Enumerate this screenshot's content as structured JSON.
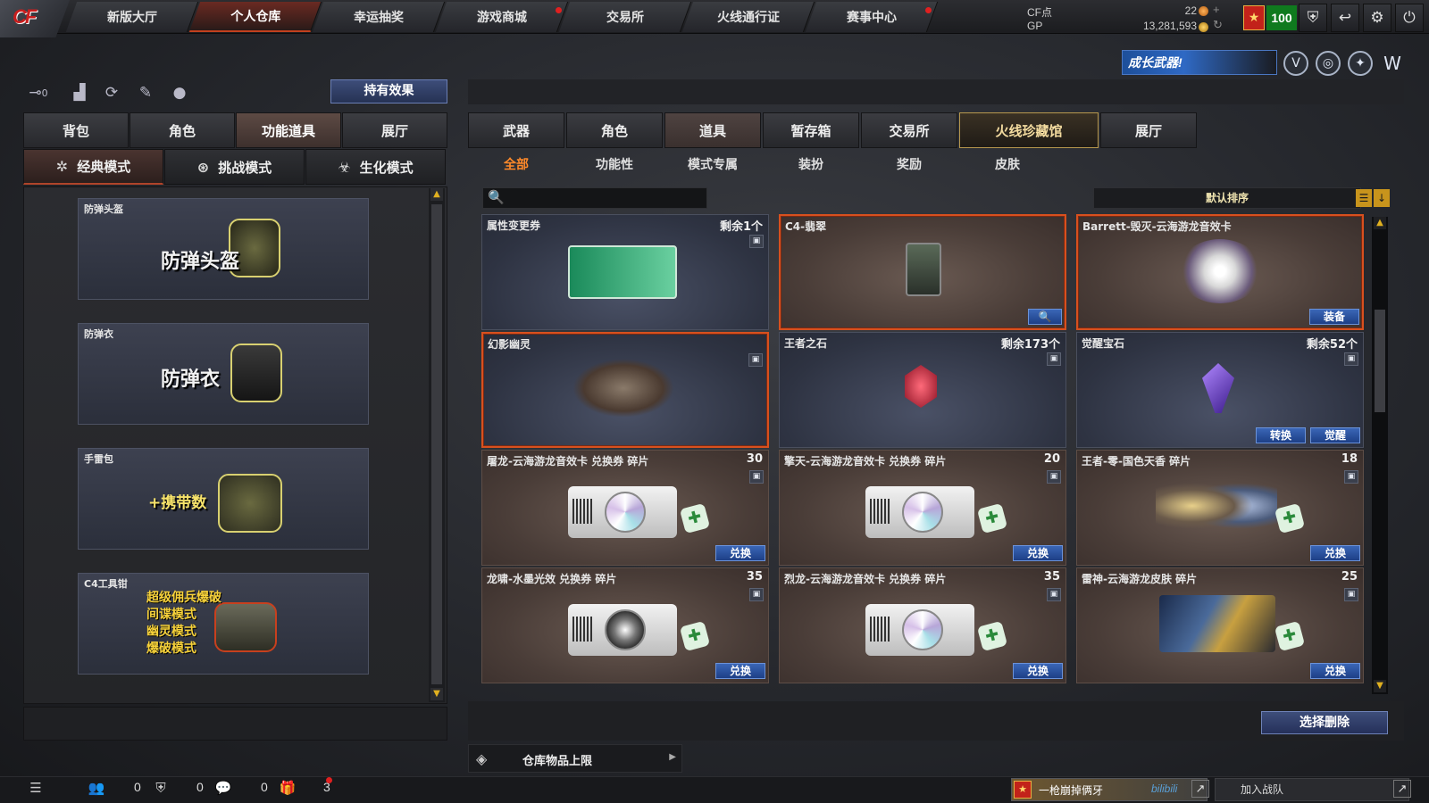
{
  "nav": {
    "logo": "CF",
    "tabs": [
      {
        "label": "新版大厅",
        "dot": false
      },
      {
        "label": "个人仓库",
        "dot": false
      },
      {
        "label": "幸运抽奖",
        "dot": false
      },
      {
        "label": "游戏商城",
        "dot": true
      },
      {
        "label": "交易所",
        "dot": false
      },
      {
        "label": "火线通行证",
        "dot": false
      },
      {
        "label": "赛事中心",
        "dot": true
      }
    ],
    "currency": {
      "cf_label": "CF点",
      "cf_value": "22",
      "gp_label": "GP",
      "gp_value": "13,281,593"
    },
    "level": "100"
  },
  "header_icons": {
    "growth_weapon": "成长武器!"
  },
  "left": {
    "icon_names": [
      "key-icon",
      "podium-icon",
      "refresh-icon",
      "brush-icon",
      "grenade-icon"
    ],
    "key_count": "0",
    "effects_button": "持有效果",
    "tabs": [
      "背包",
      "角色",
      "功能道具",
      "展厅"
    ],
    "mode_tabs": [
      "经典模式",
      "挑战模式",
      "生化模式"
    ],
    "cards": [
      {
        "title": "防弹头盔",
        "big": "防弹头盔"
      },
      {
        "title": "防弹衣",
        "big": "防弹衣"
      },
      {
        "title": "手雷包",
        "big": "+携带数"
      },
      {
        "title": "C4工具钳",
        "lines": [
          "超级佣兵爆破",
          "间谍模式",
          "幽灵模式",
          "爆破模式"
        ]
      }
    ]
  },
  "right": {
    "tabs": [
      "武器",
      "角色",
      "道具",
      "暂存箱",
      "交易所",
      "火线珍藏馆",
      "展厅"
    ],
    "subtabs": [
      "全部",
      "功能性",
      "模式专属",
      "装扮",
      "奖励",
      "皮肤"
    ],
    "search_placeholder": "",
    "sort_label": "默认排序",
    "items": [
      {
        "name": "属性变更券",
        "count": "剩余1个",
        "buttons": []
      },
      {
        "name": "C4-翡翠",
        "count": "",
        "buttons": []
      },
      {
        "name": "Barrett-毁灭-云海游龙音效卡",
        "count": "",
        "buttons": [
          "装备"
        ]
      },
      {
        "name": "幻影幽灵",
        "count": "",
        "buttons": []
      },
      {
        "name": "王者之石",
        "count": "剩余173个",
        "buttons": []
      },
      {
        "name": "觉醒宝石",
        "count": "剩余52个",
        "buttons": [
          "转换",
          "觉醒"
        ]
      },
      {
        "name": "屠龙-云海游龙音效卡 兑换券 碎片",
        "count": "30",
        "buttons": [
          "兑换"
        ]
      },
      {
        "name": "擎天-云海游龙音效卡 兑换券 碎片",
        "count": "20",
        "buttons": [
          "兑换"
        ]
      },
      {
        "name": "王者-零-国色天香 碎片",
        "count": "18",
        "buttons": [
          "兑换"
        ]
      },
      {
        "name": "龙啸-水墨光效 兑换券 碎片",
        "count": "35",
        "buttons": [
          "兑换"
        ]
      },
      {
        "name": "烈龙-云海游龙音效卡 兑换券 碎片",
        "count": "35",
        "buttons": [
          "兑换"
        ]
      },
      {
        "name": "雷神-云海游龙皮肤 碎片",
        "count": "25",
        "buttons": [
          "兑换"
        ]
      }
    ],
    "bulk_delete": "选择删除",
    "capacity_label": "仓库物品上限"
  },
  "status": {
    "friends": "0",
    "guild": "0",
    "chat": "0",
    "gifts": "3",
    "news": "一枪崩掉俩牙",
    "news_source": "bilibili",
    "join_team": "加入战队"
  },
  "colors": {
    "accent": "#d8501e",
    "gold": "#c8941c",
    "button_blue": "#2a52a0"
  }
}
